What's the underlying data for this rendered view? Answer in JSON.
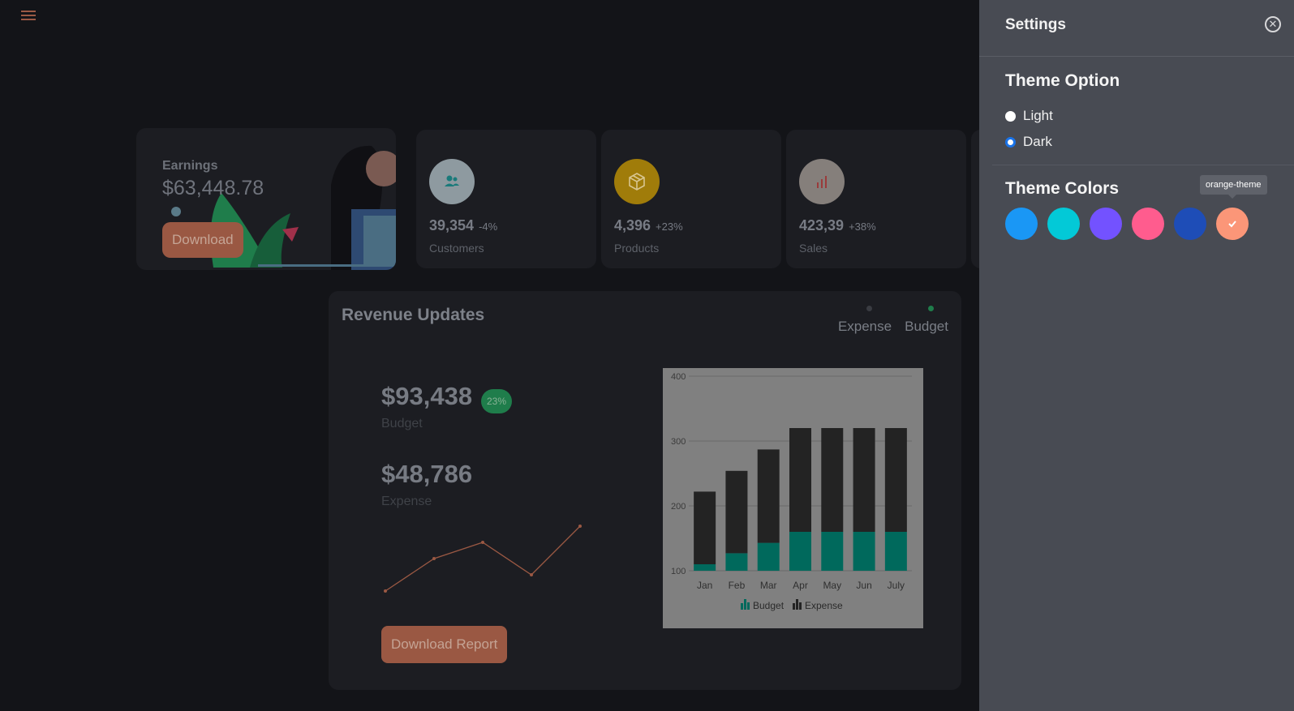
{
  "earnings": {
    "label": "Earnings",
    "amount": "$63,448.78",
    "button": "Download"
  },
  "stats": [
    {
      "value": "39,354",
      "change": "-4%",
      "label": "Customers",
      "icon": "customers-icon",
      "color": "#8e9aa0"
    },
    {
      "value": "4,396",
      "change": "+23%",
      "label": "Products",
      "icon": "box-icon",
      "color": "#a07c0a"
    },
    {
      "value": "423,39",
      "change": "+38%",
      "label": "Sales",
      "icon": "bar-chart-icon",
      "color": "#857f7b"
    }
  ],
  "revenue": {
    "title": "Revenue Updates",
    "legend": [
      {
        "label": "Expense",
        "color": "#3a3c42"
      },
      {
        "label": "Budget",
        "color": "#1f7d4b"
      }
    ],
    "budget_amount": "$93,438",
    "budget_badge": "23%",
    "budget_label": "Budget",
    "expense_amount": "$48,786",
    "expense_label": "Expense",
    "report_button": "Download Report"
  },
  "chart_data": {
    "type": "bar",
    "stacked": true,
    "categories": [
      "Jan",
      "Feb",
      "Mar",
      "Apr",
      "May",
      "Jun",
      "July"
    ],
    "series": [
      {
        "name": "Budget",
        "values": [
          10,
          27,
          43,
          60,
          60,
          60,
          60
        ],
        "color": "#00695c"
      },
      {
        "name": "Expense",
        "values": [
          112,
          127,
          144,
          160,
          160,
          160,
          160
        ],
        "color": "#232323"
      }
    ],
    "ylim": [
      100,
      400
    ],
    "yticks": [
      100,
      200,
      300,
      400
    ],
    "legend_position": "bottom",
    "grid": true
  },
  "sparkline": {
    "values": [
      1,
      5,
      7,
      3,
      9
    ]
  },
  "settings": {
    "title": "Settings",
    "theme_option_title": "Theme Option",
    "options": [
      "Light",
      "Dark"
    ],
    "selected_option": "Dark",
    "theme_colors_title": "Theme Colors",
    "colors": [
      {
        "name": "blue-theme",
        "hex": "#1a97f5"
      },
      {
        "name": "cyan-theme",
        "hex": "#03c9d7"
      },
      {
        "name": "purple-theme",
        "hex": "#7352ff"
      },
      {
        "name": "pink-theme",
        "hex": "#ff5c8e"
      },
      {
        "name": "indigo-theme",
        "hex": "#1e4db7"
      },
      {
        "name": "orange-theme",
        "hex": "#fb9678"
      }
    ],
    "selected_color": "orange-theme",
    "tooltip": "orange-theme"
  }
}
